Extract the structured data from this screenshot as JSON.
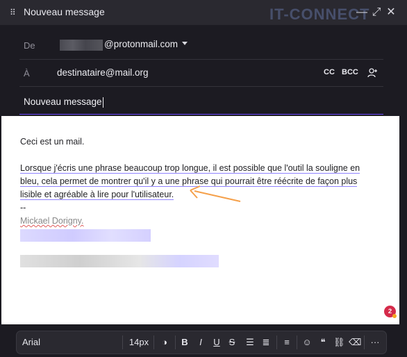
{
  "window": {
    "title": "Nouveau message",
    "watermark": "IT-CONNECT"
  },
  "title_controls": {
    "drag": "⠿",
    "minimize": "—",
    "expand": "⤢",
    "close": "✕"
  },
  "from": {
    "label": "De",
    "address_visible": "@protonmail.com"
  },
  "to": {
    "label": "À",
    "value": "destinataire@mail.org",
    "cc": "CC",
    "bcc": "BCC",
    "add_contact_icon": "add-contact-icon"
  },
  "subject": {
    "value": "Nouveau message"
  },
  "body": {
    "line1": "Ceci est un mail.",
    "para_lines": [
      "Lorsque j'écris une phrase beaucoup trop longue, il est possible que l'outil la souligne en",
      "bleu, cela permet de montrer qu'il y a une phrase qui pourrait être réécrite de façon plus",
      "lisible et agréable à lire pour l'utilisateur."
    ],
    "sig_sep": "--",
    "sig_name": "Mickael Dorigny."
  },
  "badge": {
    "count": "2"
  },
  "toolbar": {
    "font": "Arial",
    "size": "14px",
    "items": [
      {
        "name": "text-color-icon",
        "glyph": "◑"
      },
      {
        "name": "bold-button",
        "glyph": "B"
      },
      {
        "name": "italic-button",
        "glyph": "I"
      },
      {
        "name": "underline-button",
        "glyph": "U"
      },
      {
        "name": "strikethrough-button",
        "glyph": "S"
      },
      {
        "name": "bullet-list-button",
        "glyph": "☰"
      },
      {
        "name": "numbered-list-button",
        "glyph": "≣"
      },
      {
        "name": "align-button",
        "glyph": "≡"
      },
      {
        "name": "emoji-button",
        "glyph": "☺"
      },
      {
        "name": "quote-button",
        "glyph": "❝"
      },
      {
        "name": "link-button",
        "glyph": "⛓"
      },
      {
        "name": "clear-format-button",
        "glyph": "⌫"
      },
      {
        "name": "more-button",
        "glyph": "···"
      }
    ]
  },
  "colors": {
    "accent": "#6d4aff",
    "arrow": "#f5a04a",
    "badge": "#d52b4a"
  }
}
